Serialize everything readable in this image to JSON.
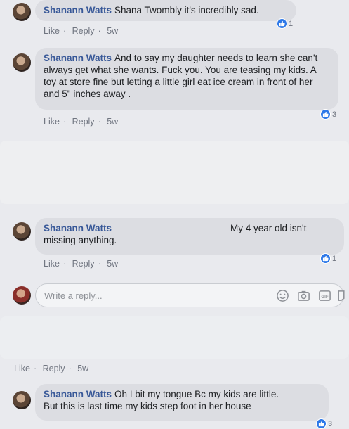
{
  "comments": [
    {
      "author": "Shanann Watts",
      "text": "Shana Twombly it's incredibly sad.",
      "like_label": "Like",
      "reply_label": "Reply",
      "time": "5w",
      "reactions": "1"
    },
    {
      "author": "Shanann Watts",
      "text": "And to say my daughter needs to learn she can't always get what she wants. Fuck you. You are teasing my kids. A toy at store fine but letting a little girl eat ice cream in front of her and 5\" inches away .",
      "like_label": "Like",
      "reply_label": "Reply",
      "time": "5w",
      "reactions": "3"
    },
    {
      "author": "Shanann Watts",
      "text_right": "My 4 year old isn't",
      "text": "missing anything.",
      "like_label": "Like",
      "reply_label": "Reply",
      "time": "5w",
      "reactions": "1"
    }
  ],
  "reply_box": {
    "placeholder": "Write a reply...",
    "icons": [
      "emoji-icon",
      "camera-icon",
      "gif-icon",
      "sticker-icon"
    ]
  },
  "parent_meta": {
    "like_label": "Like",
    "reply_label": "Reply",
    "time": "5w"
  },
  "last_comment": {
    "author": "Shanann Watts",
    "text_line1": "Oh I bit my tongue Bc my kids are little.",
    "text_line2": "But this is last time my kids step foot in her house",
    "reactions": "3"
  },
  "colors": {
    "background": "#e9eaee",
    "bubble": "#dcdde2",
    "name": "#385898",
    "like_blue": "#2d78e8",
    "meta": "#707580"
  }
}
